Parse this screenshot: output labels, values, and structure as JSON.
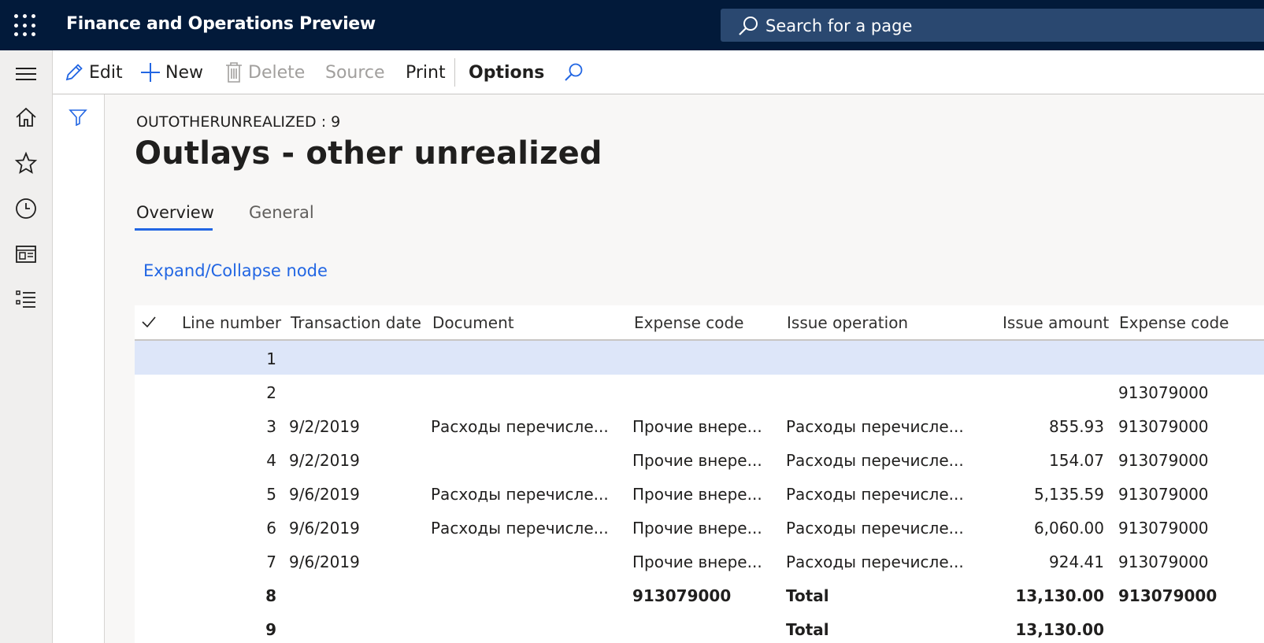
{
  "header": {
    "app_title": "Finance and Operations Preview",
    "search_placeholder": "Search for a page"
  },
  "actions": {
    "edit": "Edit",
    "new": "New",
    "delete": "Delete",
    "source": "Source",
    "print": "Print",
    "options": "Options"
  },
  "page": {
    "record_id": "OUTOTHERUNREALIZED : 9",
    "title": "Outlays - other unrealized",
    "tabs": [
      "Overview",
      "General"
    ],
    "expand_link": "Expand/Collapse node"
  },
  "grid": {
    "columns": [
      "Line number",
      "Transaction date",
      "Document",
      "Expense code",
      "Issue operation",
      "Issue amount",
      "Expense code"
    ],
    "rows": [
      {
        "line": "1",
        "date": "",
        "document": "",
        "expense_code": "",
        "issue_operation": "",
        "amount": "",
        "expense_code2": "",
        "bold": false,
        "selected": true
      },
      {
        "line": "2",
        "date": "",
        "document": "",
        "expense_code": "",
        "issue_operation": "",
        "amount": "",
        "expense_code2": "913079000",
        "bold": false,
        "selected": false
      },
      {
        "line": "3",
        "date": "9/2/2019",
        "document": "Расходы перечисле...",
        "expense_code": "Прочие внере...",
        "issue_operation": "Расходы перечисле...",
        "amount": "855.93",
        "expense_code2": "913079000",
        "bold": false,
        "selected": false
      },
      {
        "line": "4",
        "date": "9/2/2019",
        "document": "",
        "expense_code": "Прочие внере...",
        "issue_operation": "Расходы перечисле...",
        "amount": "154.07",
        "expense_code2": "913079000",
        "bold": false,
        "selected": false
      },
      {
        "line": "5",
        "date": "9/6/2019",
        "document": "Расходы перечисле...",
        "expense_code": "Прочие внере...",
        "issue_operation": "Расходы перечисле...",
        "amount": "5,135.59",
        "expense_code2": "913079000",
        "bold": false,
        "selected": false
      },
      {
        "line": "6",
        "date": "9/6/2019",
        "document": "Расходы перечисле...",
        "expense_code": "Прочие внере...",
        "issue_operation": "Расходы перечисле...",
        "amount": "6,060.00",
        "expense_code2": "913079000",
        "bold": false,
        "selected": false
      },
      {
        "line": "7",
        "date": "9/6/2019",
        "document": "",
        "expense_code": "Прочие внере...",
        "issue_operation": "Расходы перечисле...",
        "amount": "924.41",
        "expense_code2": "913079000",
        "bold": false,
        "selected": false
      },
      {
        "line": "8",
        "date": "",
        "document": "",
        "expense_code": "913079000",
        "issue_operation": "Total",
        "amount": "13,130.00",
        "expense_code2": "913079000",
        "bold": true,
        "selected": false
      },
      {
        "line": "9",
        "date": "",
        "document": "",
        "expense_code": "",
        "issue_operation": "Total",
        "amount": "13,130.00",
        "expense_code2": "",
        "bold": true,
        "selected": false
      }
    ]
  },
  "colors": {
    "topbar": "#021a3a",
    "accent": "#2266e3",
    "selected_row": "#dde6f9"
  }
}
